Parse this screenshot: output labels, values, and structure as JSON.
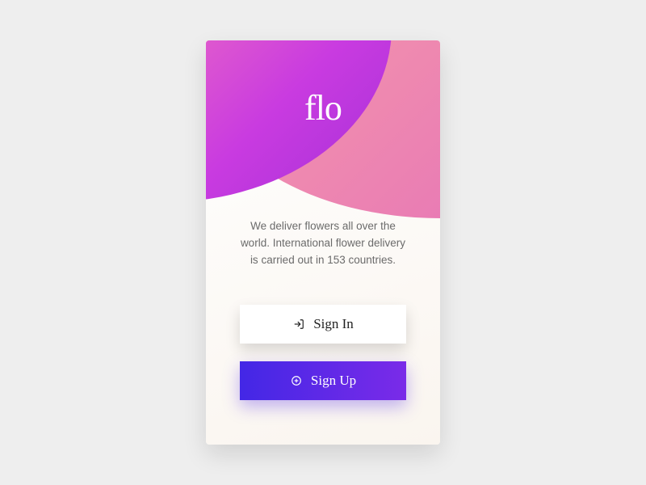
{
  "logo": "flo",
  "description": "We deliver flowers all over the world. International flower delivery is carried out in 153 countries.",
  "buttons": {
    "signin_label": "Sign In",
    "signup_label": "Sign Up"
  }
}
